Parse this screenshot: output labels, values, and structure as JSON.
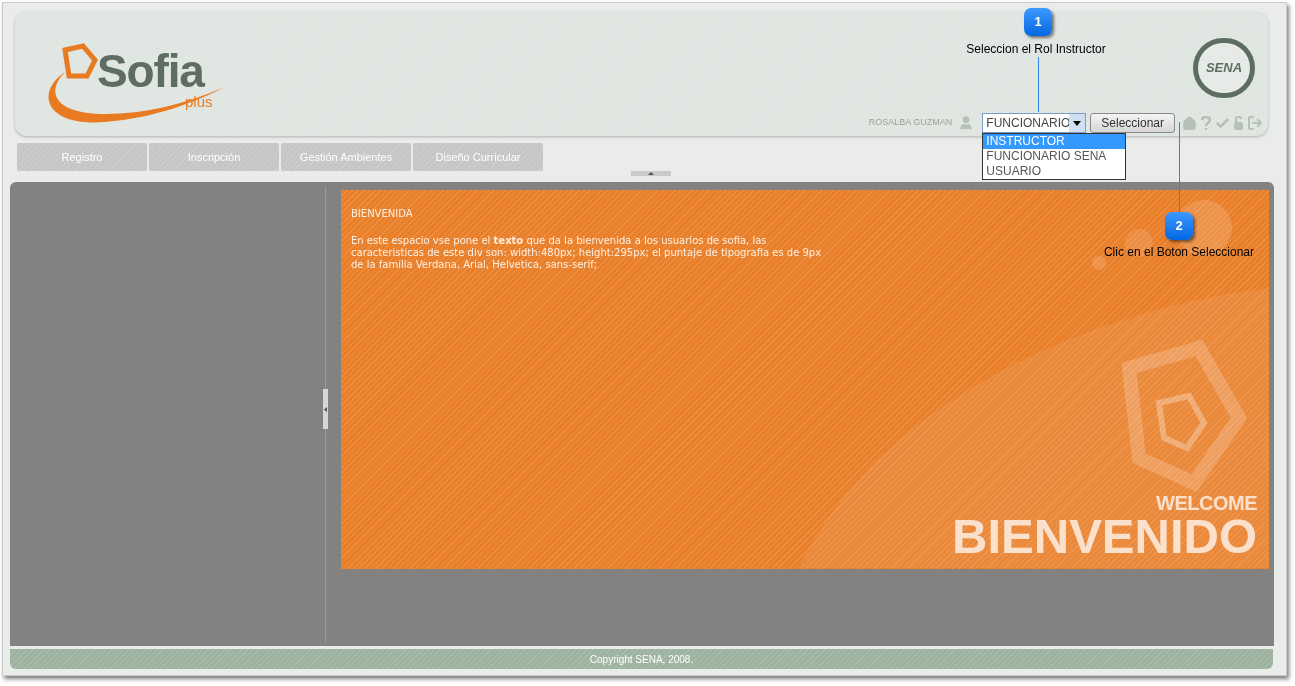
{
  "header": {
    "logo": {
      "name": "Sofia",
      "suffix": "plus"
    },
    "sena_logo": "SENA",
    "user": "ROSALBA GUZMAN",
    "role_select": {
      "value": "FUNCIONARIO",
      "expanded": true,
      "options": [
        {
          "label": "INSTRUCTOR",
          "selected": true
        },
        {
          "label": "FUNCIONARIO SENA",
          "selected": false
        },
        {
          "label": "USUARIO",
          "selected": false
        }
      ]
    },
    "select_button": "Seleccionar"
  },
  "nav": [
    "Registro",
    "Inscripción",
    "Gestión Ambientes",
    "Diseño Curricular"
  ],
  "welcome": {
    "title": "BIENVENIDA",
    "text": "En este espacio vse pone el **texto** que da la bienvenida a los usuarios de sofia, las caracteristicas de este div son: width:480px; height:295px; el puntaje de tipografia es de 9px de la familia Verdana, Arial, Helvetica, sans-serif;",
    "welcome": "WELCOME",
    "bienvenido": "BIENVENIDO"
  },
  "footer": "Copyright SENA, 2008.",
  "annotations": [
    {
      "number": "1",
      "text": "Seleccion el Rol Instructor"
    },
    {
      "number": "2",
      "text": "Clic en el Boton Seleccionar"
    }
  ]
}
